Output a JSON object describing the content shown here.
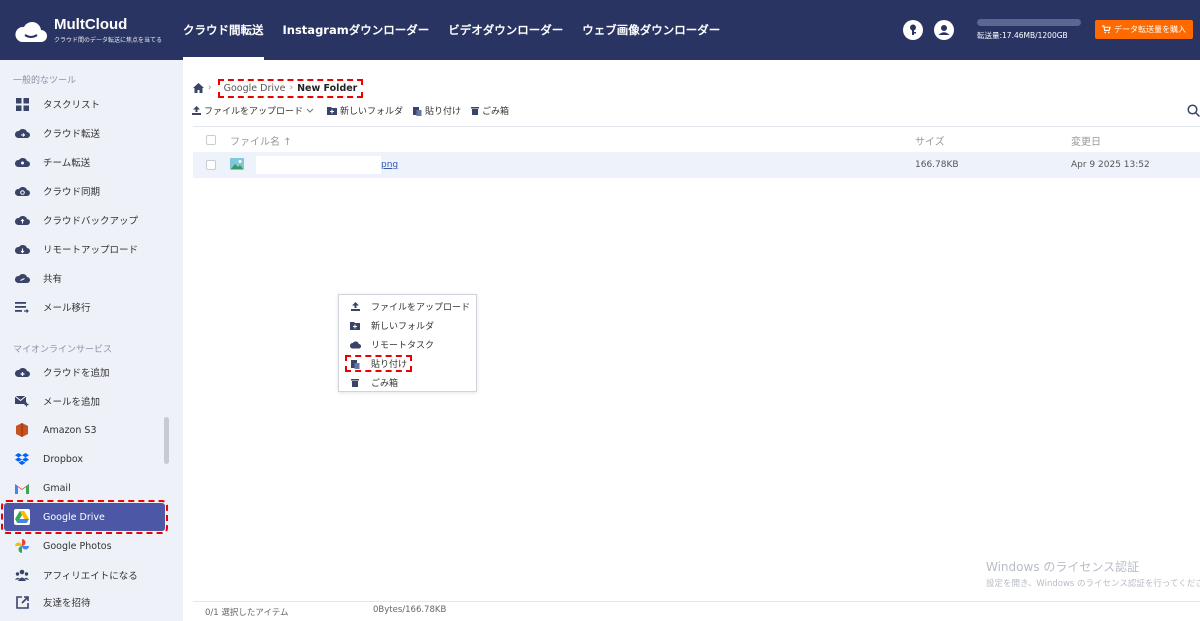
{
  "header": {
    "brand": "MultCloud",
    "tagline": "クラウド間のデータ転送に焦点を当てる",
    "nav": [
      {
        "label": "クラウド間転送",
        "active": true
      },
      {
        "label": "Instagramダウンローダー",
        "active": false
      },
      {
        "label": "ビデオダウンローダー",
        "active": false
      },
      {
        "label": "ウェブ画像ダウンローダー",
        "active": false
      }
    ],
    "usage_text": "転送量:17.46MB/1200GB",
    "buy_label": "データ転送量を購入",
    "colors": {
      "header_bg": "#293462",
      "buy_button": "#ff6a00",
      "active_item": "#4c57a6"
    }
  },
  "sidebar": {
    "section_tools": "一般的なツール",
    "tools": [
      {
        "label": "タスクリスト",
        "icon": "grid-icon"
      },
      {
        "label": "クラウド転送",
        "icon": "cloud-transfer-icon"
      },
      {
        "label": "チーム転送",
        "icon": "team-transfer-icon"
      },
      {
        "label": "クラウド同期",
        "icon": "cloud-sync-icon"
      },
      {
        "label": "クラウドバックアップ",
        "icon": "cloud-backup-icon"
      },
      {
        "label": "リモートアップロード",
        "icon": "remote-upload-icon"
      },
      {
        "label": "共有",
        "icon": "share-icon"
      },
      {
        "label": "メール移行",
        "icon": "email-migration-icon"
      }
    ],
    "section_services": "マイオンラインサービス",
    "services": [
      {
        "label": "クラウドを追加",
        "icon": "add-cloud-icon"
      },
      {
        "label": "メールを追加",
        "icon": "add-email-icon"
      },
      {
        "label": "Amazon S3",
        "icon": "amazon-s3-icon"
      },
      {
        "label": "Dropbox",
        "icon": "dropbox-icon"
      },
      {
        "label": "Gmail",
        "icon": "gmail-icon"
      },
      {
        "label": "Google Drive",
        "icon": "google-drive-icon",
        "active": true
      },
      {
        "label": "Google Photos",
        "icon": "google-photos-icon"
      },
      {
        "label": "アフィリエイトになる",
        "icon": "affiliate-icon"
      },
      {
        "label": "友達を招待",
        "icon": "invite-icon"
      }
    ]
  },
  "breadcrumb": {
    "drive": "Google Drive",
    "folder": "New Folder"
  },
  "toolbar": {
    "upload": "ファイルをアップロード",
    "new_folder": "新しいフォルダ",
    "paste": "貼り付け",
    "trash": "ごみ箱"
  },
  "table": {
    "col_name": "ファイル名",
    "col_size": "サイズ",
    "col_date": "変更日",
    "rows": [
      {
        "name_visible": "png",
        "size": "166.78KB",
        "date": "Apr 9 2025 13:52"
      }
    ]
  },
  "context_menu": {
    "items": [
      {
        "label": "ファイルをアップロード",
        "icon": "upload-icon"
      },
      {
        "label": "新しいフォルダ",
        "icon": "new-folder-icon"
      },
      {
        "label": "リモートタスク",
        "icon": "remote-task-icon"
      },
      {
        "label": "貼り付け",
        "icon": "paste-icon",
        "highlighted": true
      },
      {
        "label": "ごみ箱",
        "icon": "trash-icon"
      }
    ]
  },
  "watermark": {
    "line1": "Windows のライセンス認証",
    "line2": "設定を開き、Windows のライセンス認証を行ってください"
  },
  "status": {
    "selected": "0/1 選択したアイテム",
    "bytes": "0Bytes/166.78KB"
  }
}
